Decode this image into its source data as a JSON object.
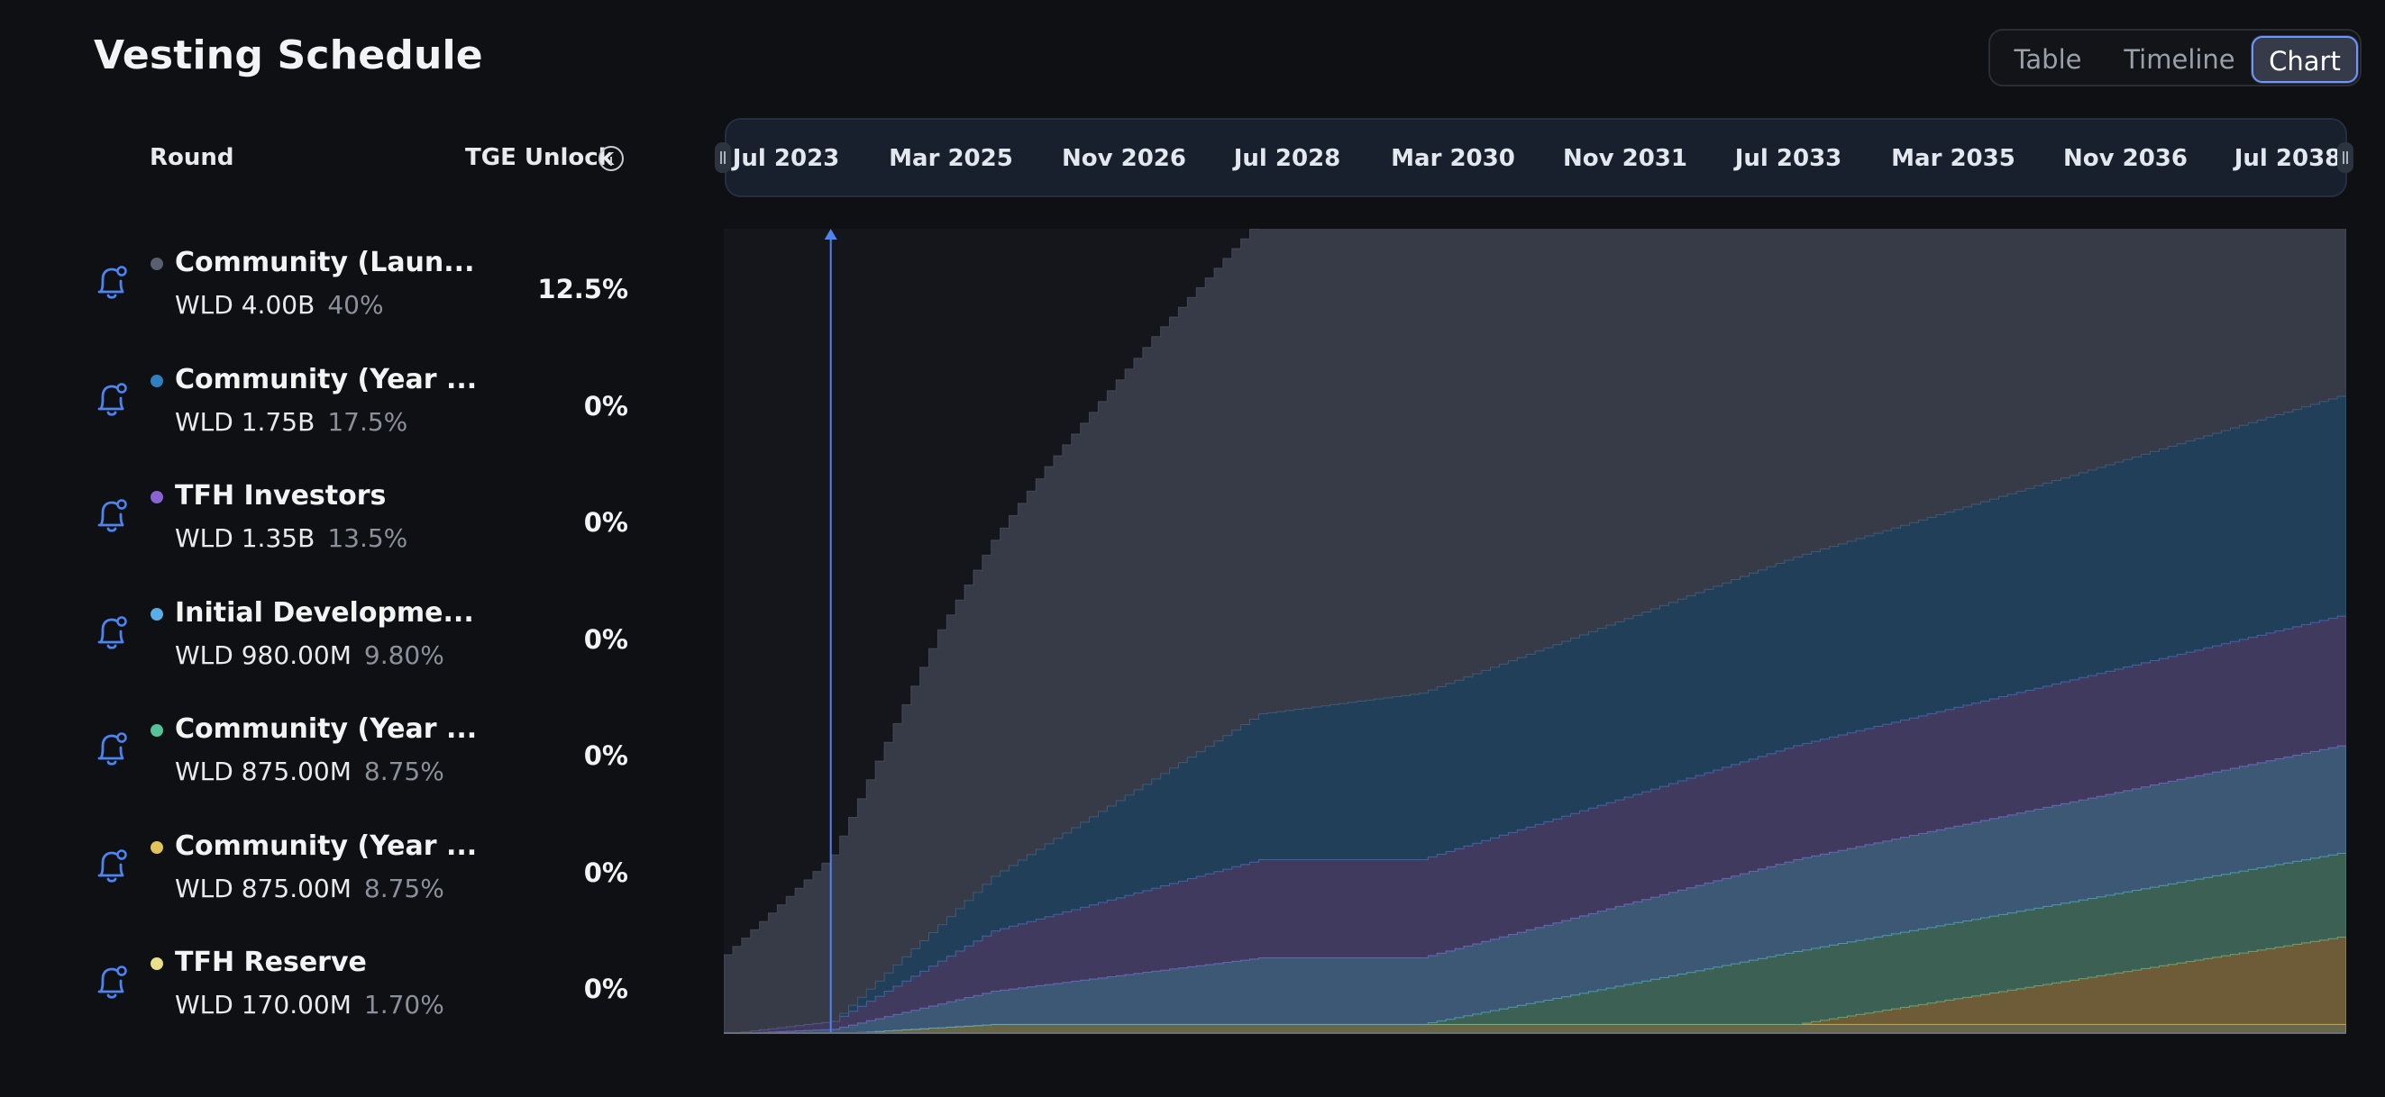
{
  "header": {
    "title": "Vesting Schedule"
  },
  "view_toggle": {
    "options": [
      "Table",
      "Timeline",
      "Chart"
    ],
    "selected": "Chart"
  },
  "columns": {
    "round": "Round",
    "tge_unlock": "TGE Unlock"
  },
  "rounds": [
    {
      "name": "Community (Laun...",
      "amount": "WLD 4.00B",
      "percent": "40%",
      "tge": "12.5%",
      "color": "#5a5f70"
    },
    {
      "name": "Community (Year ...",
      "amount": "WLD 1.75B",
      "percent": "17.5%",
      "tge": "0%",
      "color": "#2f7fc1"
    },
    {
      "name": "TFH Investors",
      "amount": "WLD 1.35B",
      "percent": "13.5%",
      "tge": "0%",
      "color": "#8a63d2"
    },
    {
      "name": "Initial Developme...",
      "amount": "WLD 980.00M",
      "percent": "9.80%",
      "tge": "0%",
      "color": "#5aaee8"
    },
    {
      "name": "Community (Year ...",
      "amount": "WLD 875.00M",
      "percent": "8.75%",
      "tge": "0%",
      "color": "#56c29a"
    },
    {
      "name": "Community (Year ...",
      "amount": "WLD 875.00M",
      "percent": "8.75%",
      "tge": "0%",
      "color": "#e0c35a"
    },
    {
      "name": "TFH Reserve",
      "amount": "WLD 170.00M",
      "percent": "1.70%",
      "tge": "0%",
      "color": "#e8e08a"
    }
  ],
  "timeline": {
    "labels": [
      "Jul 2023",
      "Mar 2025",
      "Nov 2026",
      "Jul 2028",
      "Mar 2030",
      "Nov 2031",
      "Jul 2033",
      "Mar 2035",
      "Nov 2036",
      "Jul 2038"
    ]
  },
  "chart_data": {
    "type": "area",
    "stacked": true,
    "x_range": [
      "2023-07",
      "2038-09"
    ],
    "today_marker": "2024-07",
    "grid": false,
    "legend": "none",
    "series": [
      {
        "color": "#e8e08a",
        "fill": "#6b6a4a",
        "points": [
          [
            "2023-07",
            0
          ],
          [
            "2024-07",
            0
          ],
          [
            "2026-01",
            0.06
          ],
          [
            "2038-09",
            0.06
          ]
        ]
      },
      {
        "color": "#e0c35a",
        "fill": "#735f3a",
        "points": [
          [
            "2023-07",
            0
          ],
          [
            "2033-07",
            0
          ],
          [
            "2038-09",
            0.56
          ]
        ]
      },
      {
        "color": "#56c29a",
        "fill": "#3f6457",
        "points": [
          [
            "2023-07",
            0
          ],
          [
            "2030-01",
            0
          ],
          [
            "2033-07",
            0.46
          ],
          [
            "2038-09",
            0.53
          ]
        ]
      },
      {
        "color": "#5aaee8",
        "fill": "#3f5c79",
        "points": [
          [
            "2023-07",
            0
          ],
          [
            "2024-07",
            0.03
          ],
          [
            "2026-01",
            0.21
          ],
          [
            "2028-07",
            0.42
          ],
          [
            "2030-01",
            0.42
          ],
          [
            "2033-07",
            0.58
          ],
          [
            "2038-09",
            0.68
          ]
        ]
      },
      {
        "color": "#8a63d2",
        "fill": "#433c63",
        "points": [
          [
            "2023-07",
            0
          ],
          [
            "2024-07",
            0.05
          ],
          [
            "2026-01",
            0.38
          ],
          [
            "2028-07",
            0.62
          ],
          [
            "2030-01",
            0.62
          ],
          [
            "2033-07",
            0.72
          ],
          [
            "2038-09",
            0.82
          ]
        ]
      },
      {
        "color": "#2f7fc1",
        "fill": "#22415d",
        "points": [
          [
            "2023-07",
            0
          ],
          [
            "2024-07",
            0
          ],
          [
            "2028-07",
            0.92
          ],
          [
            "2030-01",
            1.05
          ],
          [
            "2033-07",
            1.19
          ],
          [
            "2038-09",
            1.39
          ]
        ]
      },
      {
        "color": "#5a5f70",
        "fill": "#393c4a",
        "points": [
          [
            "2023-07",
            0.5
          ],
          [
            "2024-07",
            1.05
          ],
          [
            "2025-07",
            1.86
          ],
          [
            "2026-07",
            2.38
          ],
          [
            "2027-07",
            2.79
          ],
          [
            "2028-07",
            3.12
          ],
          [
            "2030-01",
            3.36
          ],
          [
            "2033-07",
            3.93
          ],
          [
            "2038-09",
            4.34
          ]
        ]
      }
    ],
    "stack_order_bottom_to_top": true,
    "y_units": "WLD B",
    "ylim": [
      0,
      5.08
    ]
  }
}
